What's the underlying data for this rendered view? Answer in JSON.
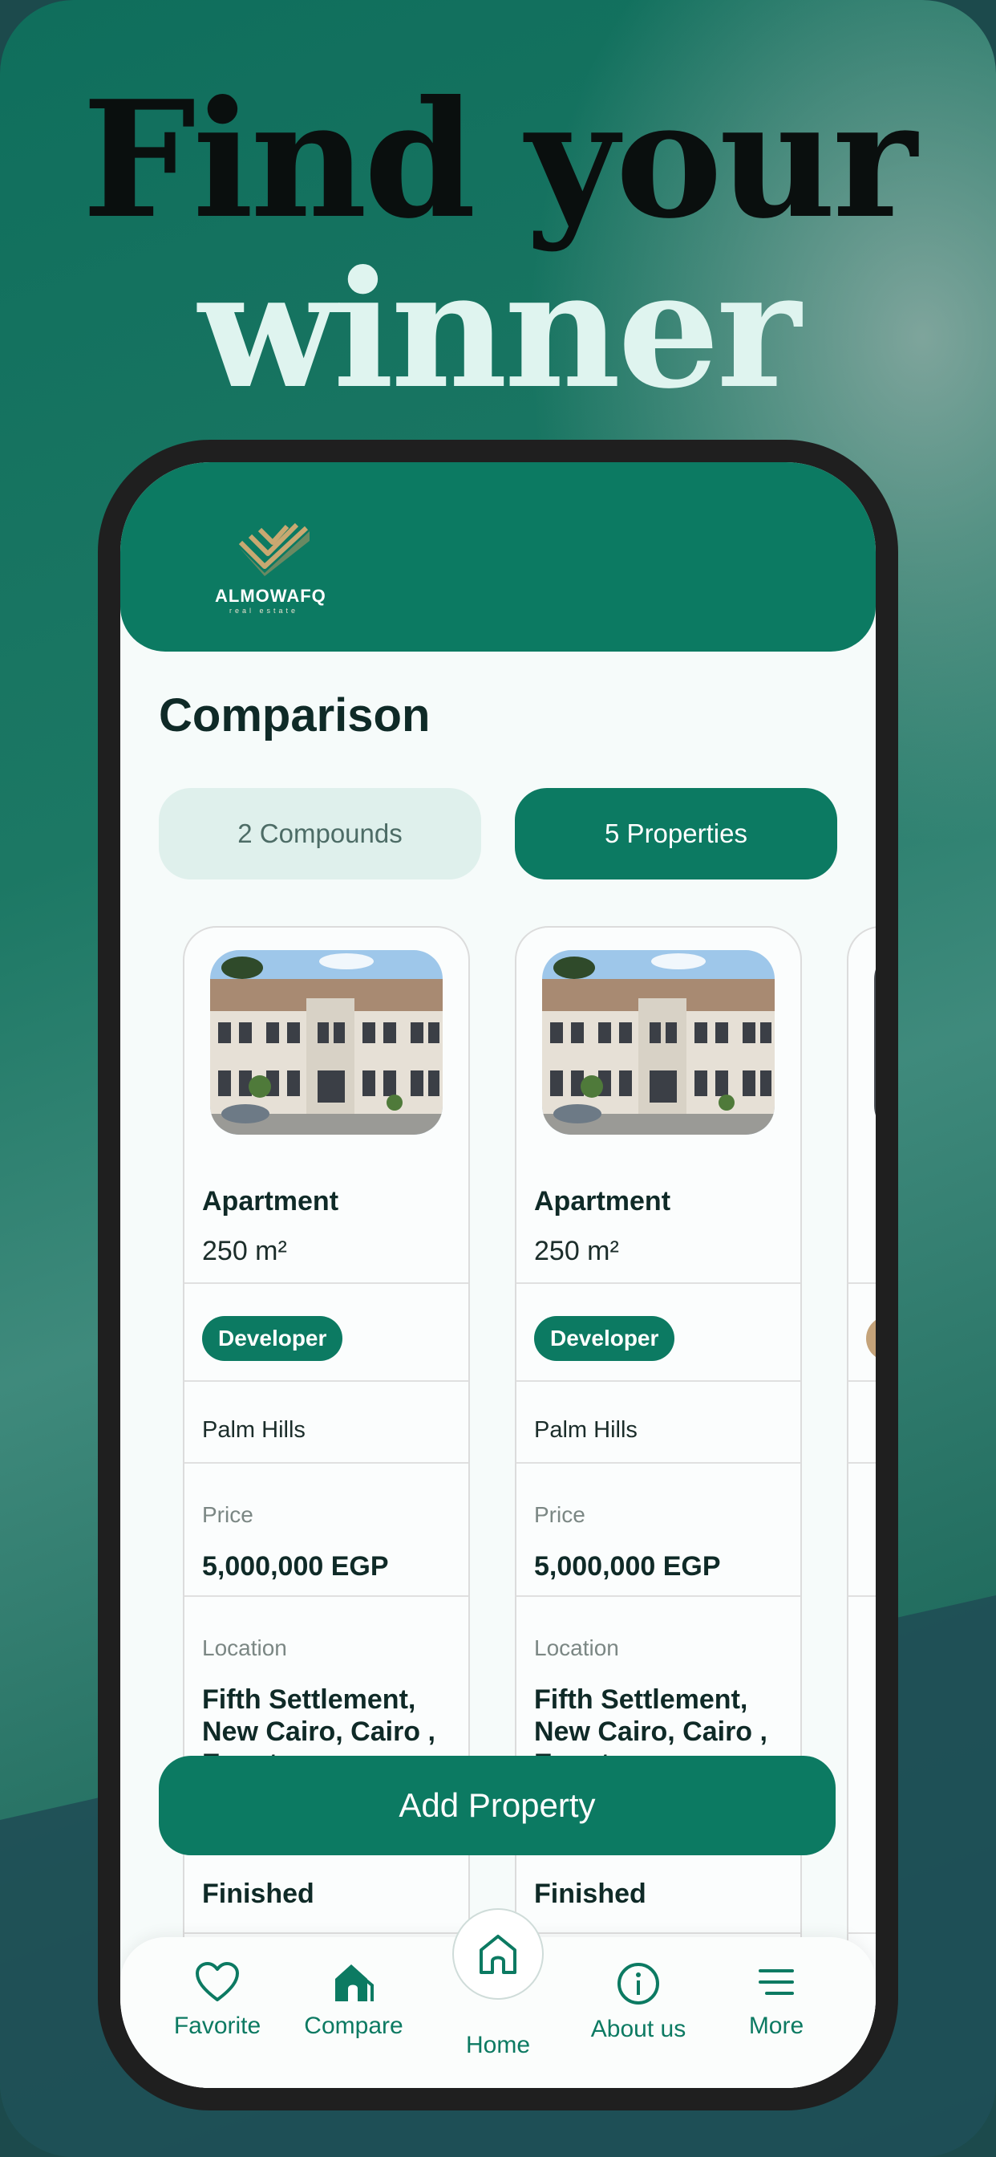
{
  "headline": {
    "line1": "Find your",
    "line2": "winner"
  },
  "brand": {
    "name": "ALMOWAFQ",
    "tagline": "real estate"
  },
  "screen": {
    "title": "Comparison"
  },
  "tabs": [
    {
      "label": "2 Compounds",
      "selected": false
    },
    {
      "label": "5 Properties",
      "selected": true
    }
  ],
  "cards": [
    {
      "type": "Apartment",
      "area": "250 m²",
      "badge": "Developer",
      "developer": "Palm Hills",
      "price_label": "Price",
      "price": "5,000,000 EGP",
      "location_label": "Location",
      "location": "Fifth Settlement, New Cairo, Cairo , Egypt",
      "finishing": "Finished"
    },
    {
      "type": "Apartment",
      "area": "250 m²",
      "badge": "Developer",
      "developer": "Palm Hills",
      "price_label": "Price",
      "price": "5,000,000 EGP",
      "location_label": "Location",
      "location": "Fifth Settlement, New Cairo, Cairo , Egypt",
      "finishing": "Finished"
    }
  ],
  "actions": {
    "add_property": "Add Property"
  },
  "nav": [
    {
      "label": "Favorite",
      "icon": "heart-icon"
    },
    {
      "label": "Compare",
      "icon": "compare-home-icon"
    },
    {
      "label": "Home",
      "icon": "home-icon",
      "active": true
    },
    {
      "label": "About us",
      "icon": "info-icon"
    },
    {
      "label": "More",
      "icon": "menu-icon"
    }
  ],
  "colors": {
    "primary": "#0c7a62",
    "tab_inactive": "#dff0ec",
    "headline_dark": "#0a0f0e",
    "headline_light": "#dff4ef"
  }
}
